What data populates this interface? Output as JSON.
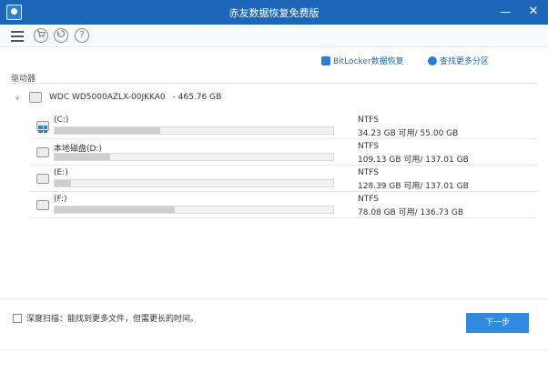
{
  "window": {
    "title": "赤友数据恢复免费版",
    "minimize_glyph": "—",
    "close_glyph": "✕"
  },
  "toolbar": {
    "icons": [
      "menu-icon",
      "cart-icon",
      "restore-icon",
      "help-icon"
    ],
    "help_glyph": "?"
  },
  "links": {
    "bitlocker": "BitLocker数据恢复",
    "find_partition": "查找更多分区"
  },
  "section_label": "驱动器",
  "disk": {
    "name": "WDC WD5000AZLX-00JKKA0",
    "size": "- 465.76 GB"
  },
  "partitions": [
    {
      "label": "(C:)",
      "fs": "NTFS",
      "space": "34.23 GB 可用/ 55.00 GB",
      "used_fraction": 0.38
    },
    {
      "label": "本地磁盘(D:)",
      "fs": "NTFS",
      "space": "109.13 GB 可用/ 137.01 GB",
      "used_fraction": 0.2
    },
    {
      "label": "(E:)",
      "fs": "NTFS",
      "space": "128.39 GB 可用/ 137.01 GB",
      "used_fraction": 0.06
    },
    {
      "label": "(F:)",
      "fs": "NTFS",
      "space": "78.08 GB 可用/ 136.73 GB",
      "used_fraction": 0.43
    }
  ],
  "deep_scan": {
    "label": "深度扫描：能找到更多文件，但需更长的时间。",
    "checked": false
  },
  "next_button": "下一步",
  "colors": {
    "title_bar": "#1c65b8",
    "accent": "#2f8ae0",
    "link": "#1c65b8",
    "bar_fill": "#cfcfcf"
  }
}
